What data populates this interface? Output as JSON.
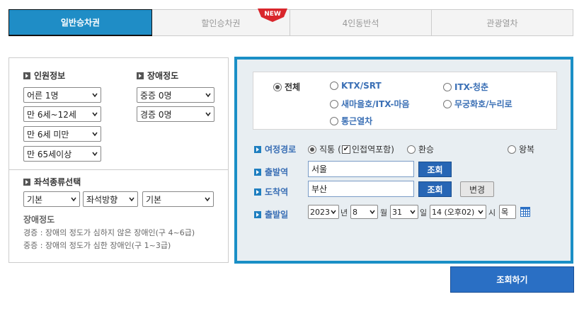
{
  "tabs": [
    {
      "label": "일반승차권"
    },
    {
      "label": "할인승차권",
      "badge": "NEW"
    },
    {
      "label": "4인동반석"
    },
    {
      "label": "관광열차"
    }
  ],
  "left": {
    "passenger_title": "인원정보",
    "disability_title": "장애정도",
    "passengers": [
      "어른 1명",
      "만 6세~12세",
      "만 6세 미만",
      "만 65세이상"
    ],
    "disability": [
      "중증 0명",
      "경증 0명"
    ],
    "seat_title": "좌석종류선택",
    "seat_selects": [
      "기본",
      "좌석방향",
      "기본"
    ],
    "note_title": "장애정도",
    "notes": [
      "경증 : 장애의 정도가 심하지 않은 장애인(구 4~6급)",
      "중증 : 장애의 정도가 심한 장애인(구 1~3급)"
    ]
  },
  "train_types": {
    "all": "전체",
    "ktx": "KTX/SRT",
    "itx_cheongchun": "ITX-청춘",
    "saemaeul": "새마을호/ITX-마음",
    "mugunghwa": "무궁화호/누리로",
    "commuter": "통근열차"
  },
  "route": {
    "label": "여정경로",
    "direct": "직통",
    "adjacent": "인접역포함",
    "transfer": "환승",
    "roundtrip": "왕복"
  },
  "departure": {
    "label": "출발역",
    "value": "서울",
    "search": "조회"
  },
  "arrival": {
    "label": "도착역",
    "value": "부산",
    "search": "조회",
    "swap": "변경"
  },
  "date": {
    "label": "출발일",
    "year": "2023",
    "year_unit": "년",
    "month": "8",
    "month_unit": "월",
    "day": "31",
    "day_unit": "일",
    "hour": "14 (오후02)",
    "hour_unit": "시",
    "weekday": "목"
  },
  "search_button": "조회하기",
  "colors": {
    "accent": "#1f8dc6",
    "label_blue": "#3a6fb5",
    "button_blue": "#2a6fc4"
  }
}
